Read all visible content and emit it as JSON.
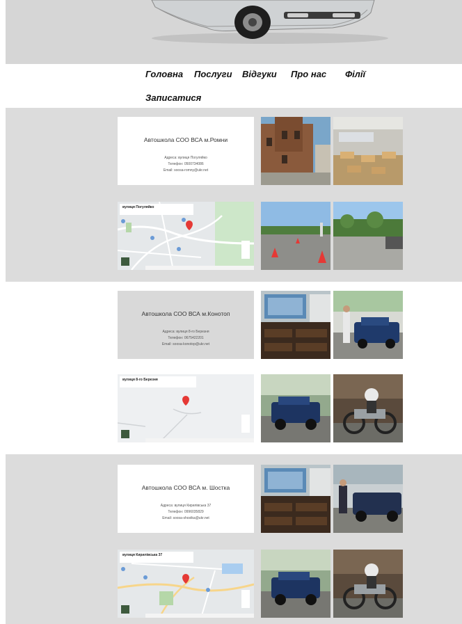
{
  "nav": {
    "items": [
      {
        "label": "Головна"
      },
      {
        "label": "Послуги"
      },
      {
        "label": "Відгуки"
      },
      {
        "label": "Про нас"
      },
      {
        "label": "Філії"
      },
      {
        "label": "Записатися"
      }
    ]
  },
  "branches": [
    {
      "title": "Автошкола СОО ВСА м.Ромни",
      "address": "Адреса: вулиця Погуляйко",
      "phone": "Телефон: 0500734086",
      "email": "Email: soosa-romny@ukr.net",
      "map_label": "вулиця Погуляйко"
    },
    {
      "title": "Автошкола СОО ВСА м.Конотоп",
      "address": "Адреса: вулиця 8-го Березня",
      "phone": "Телефон: 0675422201",
      "email": "Email: soosa-konotop@ukr.net",
      "map_label": "вулиця 8-го Березня"
    },
    {
      "title": "Автошкола СОО ВСА м. Шостка",
      "address": "Адреса: вулиця Кирилівська 37",
      "phone": "Телефон: 0996035829",
      "email": "Email: soosa-shostka@ukr.net",
      "map_label": "вулиця Кирилівська 37"
    }
  ]
}
